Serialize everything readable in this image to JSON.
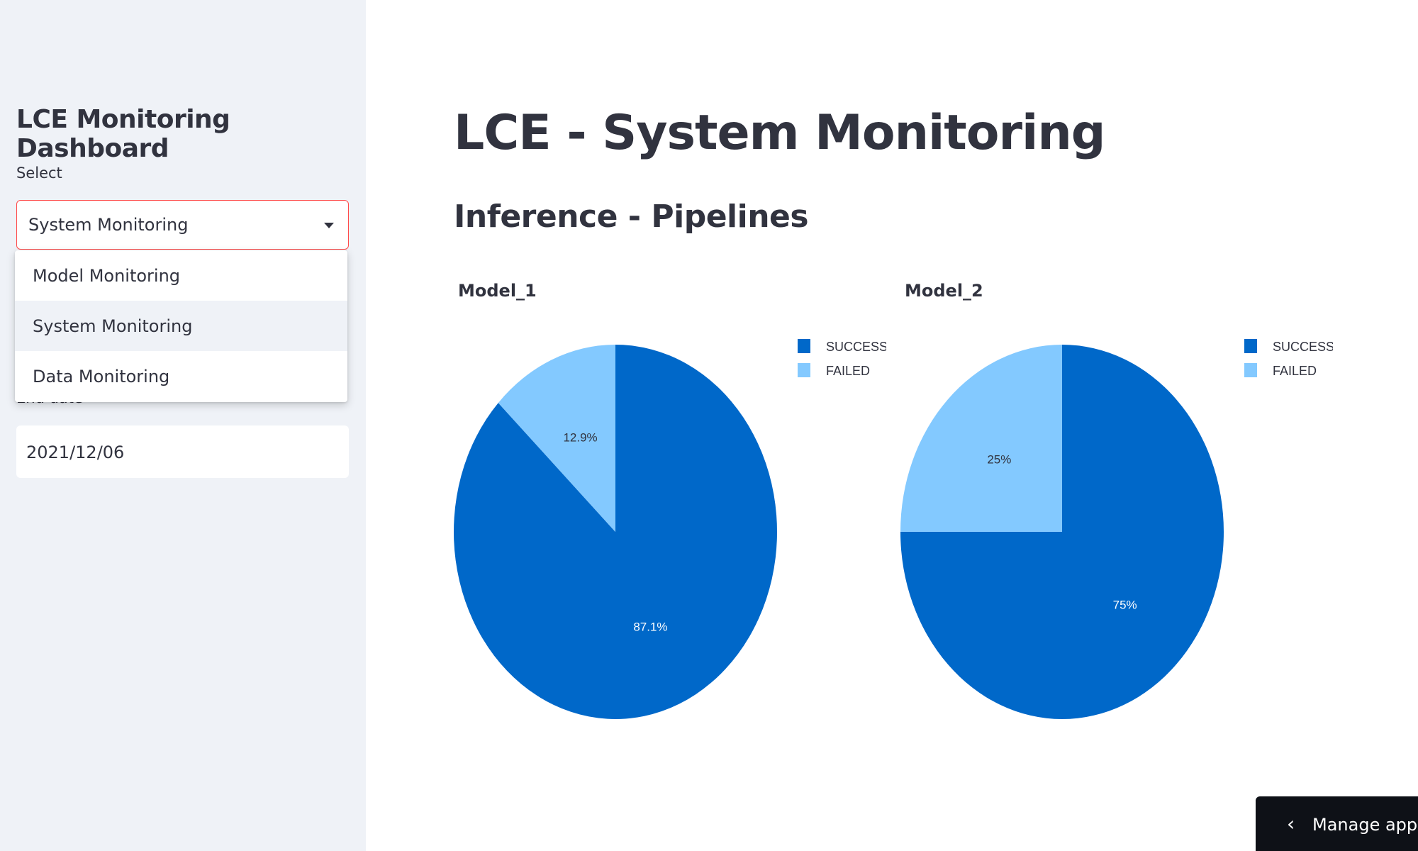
{
  "sidebar": {
    "title": "LCE Monitoring Dashboard",
    "select_label": "Select",
    "select_value": "System Monitoring",
    "options": [
      "Model Monitoring",
      "System Monitoring",
      "Data Monitoring"
    ],
    "selected_option": "System Monitoring",
    "end_date_label": "End date",
    "end_date_value": "2021/12/06"
  },
  "main": {
    "title": "LCE - System Monitoring",
    "subtitle": "Inference - Pipelines"
  },
  "chart_data": [
    {
      "type": "pie",
      "title": "Model_1",
      "labels": [
        "SUCCESS",
        "FAILED"
      ],
      "values": [
        87.1,
        12.9
      ],
      "data_labels": [
        "87.1%",
        "12.9%"
      ],
      "colors": [
        "#0068c9",
        "#83c9ff"
      ],
      "legend": "top-right"
    },
    {
      "type": "pie",
      "title": "Model_2",
      "labels": [
        "SUCCESS",
        "FAILED"
      ],
      "values": [
        75,
        25
      ],
      "data_labels": [
        "75%",
        "25%"
      ],
      "colors": [
        "#0068c9",
        "#83c9ff"
      ],
      "legend": "top-right"
    }
  ],
  "manage_app": {
    "label": "Manage app",
    "icon": "chevron-left-icon"
  }
}
